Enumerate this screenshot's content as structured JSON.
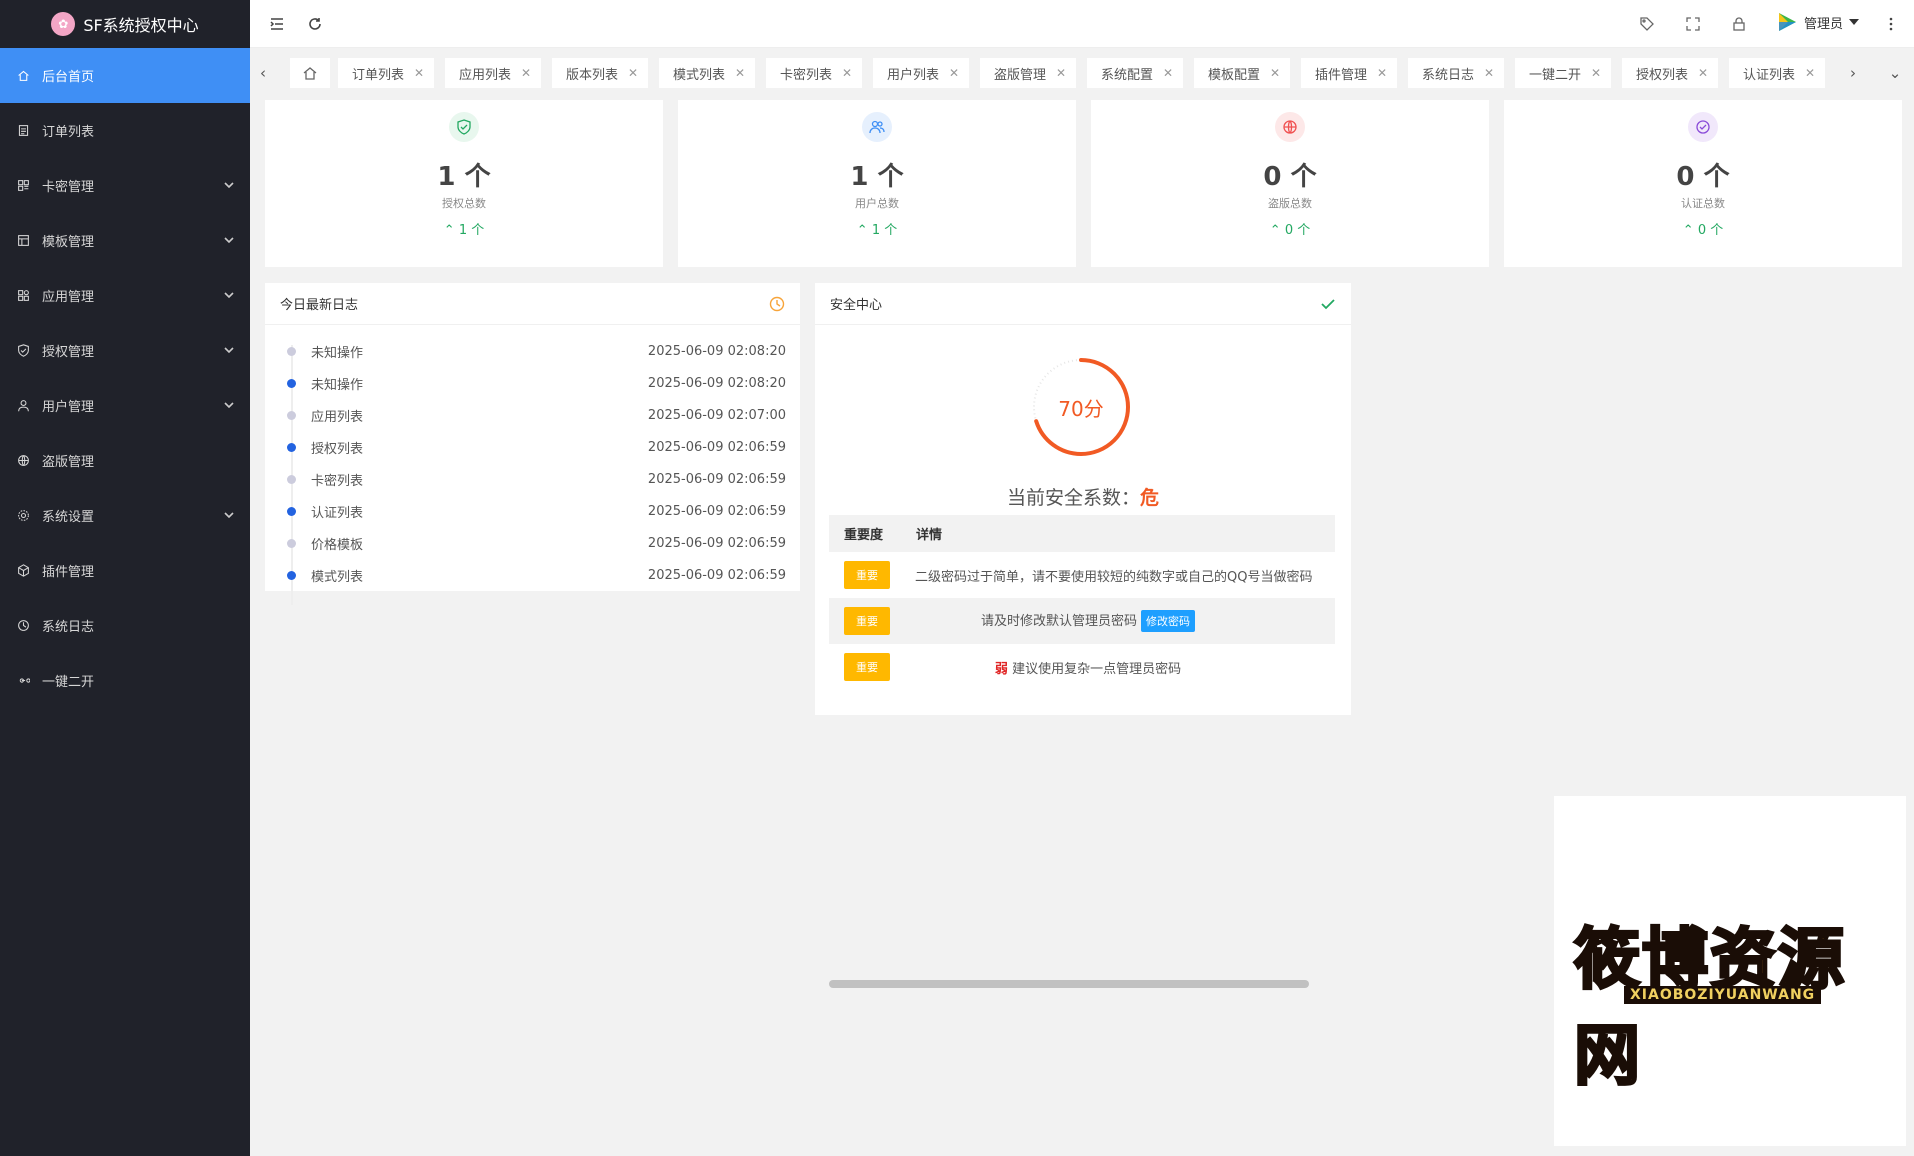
{
  "app": {
    "title": "SF系统授权中心"
  },
  "sidebar": {
    "items": [
      {
        "label": "后台首页",
        "icon": "home-icon",
        "active": true,
        "expandable": false
      },
      {
        "label": "订单列表",
        "icon": "document-icon",
        "active": false,
        "expandable": false
      },
      {
        "label": "卡密管理",
        "icon": "grid-icon",
        "active": false,
        "expandable": true
      },
      {
        "label": "模板管理",
        "icon": "template-icon",
        "active": false,
        "expandable": true
      },
      {
        "label": "应用管理",
        "icon": "apps-icon",
        "active": false,
        "expandable": true
      },
      {
        "label": "授权管理",
        "icon": "shield-check-icon",
        "active": false,
        "expandable": true
      },
      {
        "label": "用户管理",
        "icon": "user-icon",
        "active": false,
        "expandable": true
      },
      {
        "label": "盗版管理",
        "icon": "globe-icon",
        "active": false,
        "expandable": false
      },
      {
        "label": "系统设置",
        "icon": "gear-icon",
        "active": false,
        "expandable": true
      },
      {
        "label": "插件管理",
        "icon": "cube-icon",
        "active": false,
        "expandable": false
      },
      {
        "label": "系统日志",
        "icon": "clock-icon",
        "active": false,
        "expandable": false
      },
      {
        "label": "一键二开",
        "icon": "infinity-icon",
        "active": false,
        "expandable": false
      }
    ]
  },
  "header": {
    "admin_label": "管理员",
    "icons": [
      "menu-fold-icon",
      "refresh-icon",
      "tag-icon",
      "fullscreen-icon",
      "lock-icon",
      "more-icon"
    ]
  },
  "tabs": [
    {
      "label": "订单列表"
    },
    {
      "label": "应用列表"
    },
    {
      "label": "版本列表"
    },
    {
      "label": "模式列表"
    },
    {
      "label": "卡密列表"
    },
    {
      "label": "用户列表"
    },
    {
      "label": "盗版管理"
    },
    {
      "label": "系统配置"
    },
    {
      "label": "模板配置"
    },
    {
      "label": "插件管理"
    },
    {
      "label": "系统日志"
    },
    {
      "label": "一键二开"
    },
    {
      "label": "授权列表"
    },
    {
      "label": "认证列表"
    }
  ],
  "stats": [
    {
      "value": "1 个",
      "label": "授权总数",
      "trend": "1 个",
      "color": "#22a861",
      "bg": "#e8f7ee"
    },
    {
      "value": "1 个",
      "label": "用户总数",
      "trend": "1 个",
      "color": "#3f8ff5",
      "bg": "#e6f0fd"
    },
    {
      "value": "0 个",
      "label": "盗版总数",
      "trend": "0 个",
      "color": "#f05050",
      "bg": "#fde8e8"
    },
    {
      "value": "0 个",
      "label": "认证总数",
      "trend": "0 个",
      "color": "#8a4bd8",
      "bg": "#f1e8fb"
    }
  ],
  "logs": {
    "title": "今日最新日志",
    "items": [
      {
        "name": "未知操作",
        "time": "2025-06-09 02:08:20",
        "highlight": false
      },
      {
        "name": "未知操作",
        "time": "2025-06-09 02:08:20",
        "highlight": true
      },
      {
        "name": "应用列表",
        "time": "2025-06-09 02:07:00",
        "highlight": false
      },
      {
        "name": "授权列表",
        "time": "2025-06-09 02:06:59",
        "highlight": true
      },
      {
        "name": "卡密列表",
        "time": "2025-06-09 02:06:59",
        "highlight": false
      },
      {
        "name": "认证列表",
        "time": "2025-06-09 02:06:59",
        "highlight": true
      },
      {
        "name": "价格模板",
        "time": "2025-06-09 02:06:59",
        "highlight": false
      },
      {
        "name": "模式列表",
        "time": "2025-06-09 02:06:59",
        "highlight": true
      }
    ]
  },
  "security": {
    "title": "安全中心",
    "score": 70,
    "score_max": 100,
    "score_text": "70分",
    "summary_prefix": "当前安全系数：",
    "summary_level": "危",
    "columns": [
      "重要度",
      "详情"
    ],
    "rows": [
      {
        "level": "重要",
        "detail": "二级密码过于简单，请不要使用较短的纯数字或自己的QQ号当做密码",
        "weak": "",
        "button": ""
      },
      {
        "level": "重要",
        "detail": "请及时修改默认管理员密码",
        "weak": "",
        "button": "修改密码"
      },
      {
        "level": "重要",
        "detail": "建议使用复杂一点管理员密码",
        "weak": "弱",
        "button": ""
      }
    ]
  },
  "watermark": {
    "text": "筱博资源网",
    "sub": "XIAOBOZIYUANWANG"
  }
}
